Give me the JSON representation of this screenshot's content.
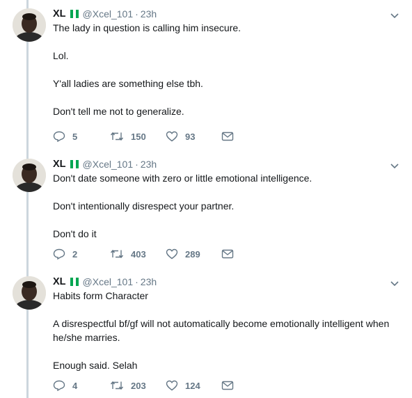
{
  "tweets": [
    {
      "name": "XL",
      "handle": "@Xcel_101",
      "dot": "·",
      "time": "23h",
      "paragraphs": [
        "The lady in question is calling him insecure.",
        "Lol.",
        "Y'all ladies are something else tbh.",
        "Don't tell me not to generalize."
      ],
      "replies": "5",
      "retweets": "150",
      "likes": "93"
    },
    {
      "name": "XL",
      "handle": "@Xcel_101",
      "dot": "·",
      "time": "23h",
      "paragraphs": [
        "Don't date someone with zero or little emotional intelligence.",
        "Don't intentionally disrespect your partner.",
        "Don't do it"
      ],
      "replies": "2",
      "retweets": "403",
      "likes": "289"
    },
    {
      "name": "XL",
      "handle": "@Xcel_101",
      "dot": "·",
      "time": "23h",
      "paragraphs": [
        "Habits form Character",
        "A disrespectful bf/gf will not automatically become emotionally intelligent when he/she marries.",
        "Enough said. Selah"
      ],
      "replies": "4",
      "retweets": "203",
      "likes": "124"
    }
  ],
  "colors": {
    "thread_line": "#ccd6dd",
    "secondary_text": "#657786",
    "flag_green": "#00a651"
  },
  "icons": [
    "reply-icon",
    "retweet-icon",
    "like-icon",
    "direct-message-icon",
    "caret-down-icon",
    "nigeria-flag-icon"
  ]
}
